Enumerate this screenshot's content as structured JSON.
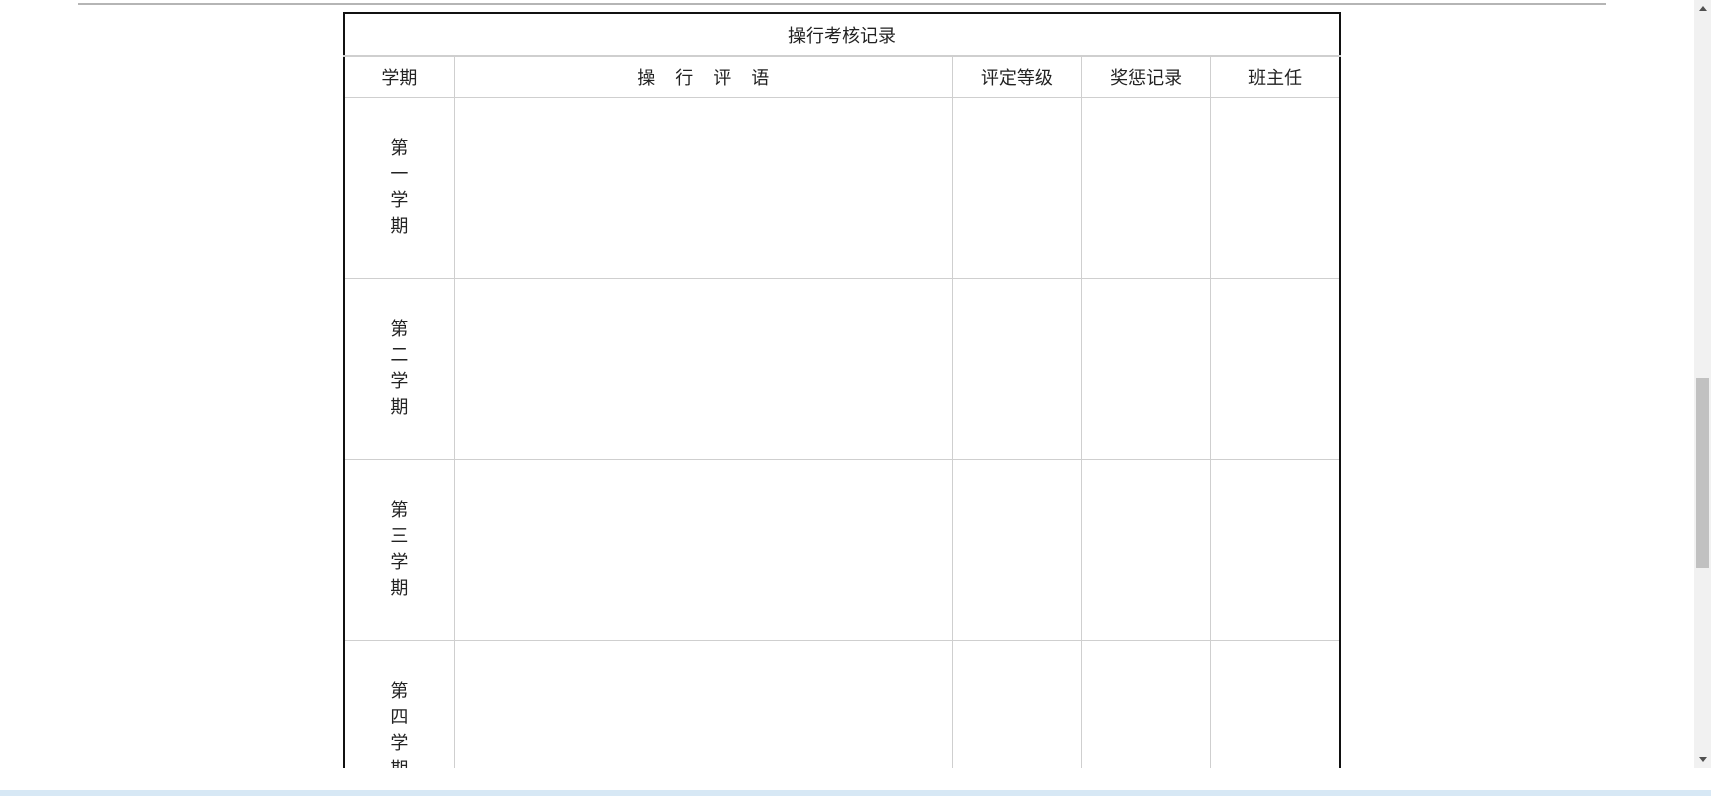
{
  "table": {
    "title": "操行考核记录",
    "headers": {
      "term": "学期",
      "comment": "操行评语",
      "grade": "评定等级",
      "reward": "奖惩记录",
      "teacher": "班主任"
    },
    "terms": [
      {
        "label": "第一学期"
      },
      {
        "label": "第二学期"
      },
      {
        "label": "第三学期"
      },
      {
        "label": "第四学期"
      }
    ]
  }
}
